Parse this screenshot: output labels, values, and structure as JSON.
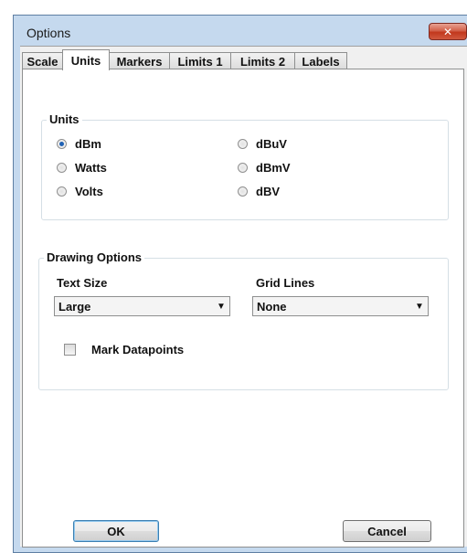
{
  "window": {
    "title": "Options",
    "close_glyph": "✕"
  },
  "tabs": [
    {
      "label": "Scale",
      "active": false
    },
    {
      "label": "Units",
      "active": true
    },
    {
      "label": "Markers",
      "active": false
    },
    {
      "label": "Limits 1",
      "active": false
    },
    {
      "label": "Limits 2",
      "active": false
    },
    {
      "label": "Labels",
      "active": false
    }
  ],
  "units_group": {
    "title": "Units",
    "options": [
      {
        "label": "dBm",
        "checked": true
      },
      {
        "label": "Watts",
        "checked": false
      },
      {
        "label": "Volts",
        "checked": false
      },
      {
        "label": "dBuV",
        "checked": false
      },
      {
        "label": "dBmV",
        "checked": false
      },
      {
        "label": "dBV",
        "checked": false
      }
    ]
  },
  "drawing_group": {
    "title": "Drawing Options",
    "text_size": {
      "label": "Text Size",
      "value": "Large"
    },
    "grid_lines": {
      "label": "Grid Lines",
      "value": "None"
    },
    "mark_datapoints": {
      "label": "Mark Datapoints",
      "checked": false
    }
  },
  "buttons": {
    "ok": "OK",
    "cancel": "Cancel"
  },
  "icons": {
    "radio_dot_color": "#1f62b5",
    "close_button_color": "#c2381d"
  }
}
